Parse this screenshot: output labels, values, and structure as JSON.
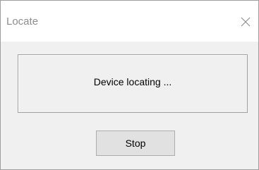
{
  "window": {
    "title": "Locate",
    "close_icon": "close-icon"
  },
  "dialog": {
    "status_text": "Device locating ...",
    "stop_label": "Stop"
  }
}
